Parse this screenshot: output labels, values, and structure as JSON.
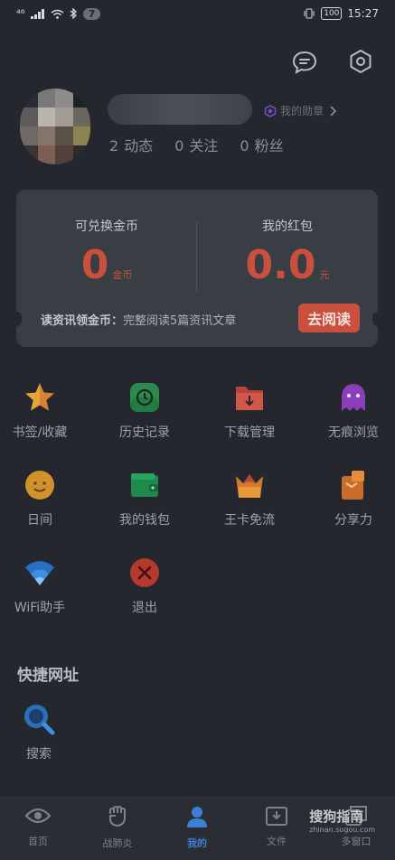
{
  "status_bar": {
    "signal": "⁴⁶",
    "notification_count": "7",
    "battery": "100",
    "time": "15:27"
  },
  "profile": {
    "medal_label": "我的勋章",
    "stats": [
      {
        "count": "2",
        "label": "动态"
      },
      {
        "count": "0",
        "label": "关注"
      },
      {
        "count": "0",
        "label": "粉丝"
      }
    ]
  },
  "wallet_card": {
    "coins_label": "可兑换金币",
    "coins_value": "0",
    "coins_unit": "金币",
    "redpacket_label": "我的红包",
    "redpacket_value": "0.0",
    "redpacket_unit": "元",
    "task_prefix": "读资讯领金币：",
    "task_text": "完整阅读5篇资讯文章",
    "task_button": "去阅读"
  },
  "grid": [
    {
      "label": "书签/收藏",
      "icon": "star-icon"
    },
    {
      "label": "历史记录",
      "icon": "clock-icon"
    },
    {
      "label": "下载管理",
      "icon": "download-folder-icon"
    },
    {
      "label": "无痕浏览",
      "icon": "ghost-icon"
    },
    {
      "label": "日间",
      "icon": "sun-face-icon"
    },
    {
      "label": "我的钱包",
      "icon": "wallet-icon"
    },
    {
      "label": "王卡免流",
      "icon": "crown-card-icon"
    },
    {
      "label": "分享力",
      "icon": "share-box-icon"
    },
    {
      "label": "WiFi助手",
      "icon": "wifi-icon"
    },
    {
      "label": "退出",
      "icon": "exit-icon"
    }
  ],
  "quick_links": {
    "title": "快捷网址",
    "items": [
      {
        "label": "搜索",
        "icon": "search-icon"
      }
    ]
  },
  "bottom_nav": [
    {
      "label": "首页",
      "icon": "eye-icon"
    },
    {
      "label": "战肺炎",
      "icon": "fist-icon"
    },
    {
      "label": "我的",
      "icon": "person-icon"
    },
    {
      "label": "文件",
      "icon": "file-download-icon"
    },
    {
      "label": "多窗口",
      "icon": "windows-icon"
    }
  ],
  "watermark": {
    "brand": "搜狗指南",
    "url": "zhinan.sogou.com"
  },
  "colors": {
    "background": "#24272d",
    "card": "#393d44",
    "accent": "#c9503c",
    "active_tab": "#3d7fd6"
  }
}
